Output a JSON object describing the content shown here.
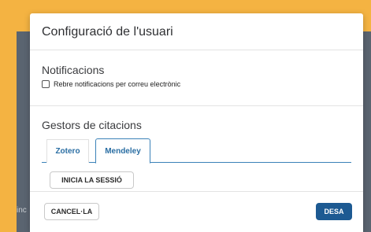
{
  "background": {
    "partial_text": "inc"
  },
  "modal": {
    "title": "Configuració de l'usuari",
    "notifications": {
      "title": "Notificacions",
      "checkbox_label": "Rebre notificacions per correu electrònic",
      "checked": false
    },
    "citation_managers": {
      "title": "Gestors de citacions",
      "tabs": [
        {
          "label": "Zotero",
          "active": false
        },
        {
          "label": "Mendeley",
          "active": true
        }
      ],
      "login_label": "INICIA LA SESSIÓ"
    },
    "footer": {
      "cancel_label": "CANCEL·LA",
      "save_label": "DESA"
    }
  },
  "colors": {
    "page_background": "#f4b342",
    "backdrop": "#5a6470",
    "accent": "#1d5a92",
    "tab_text": "#2a6ea3"
  }
}
